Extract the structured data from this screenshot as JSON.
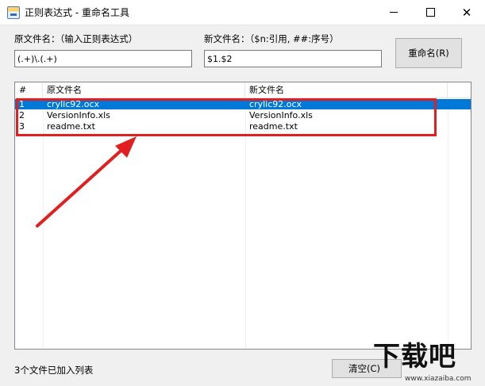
{
  "window": {
    "title": "正则表达式 - 重命名工具",
    "min_glyph": "",
    "close_glyph": "✕"
  },
  "form": {
    "source_label": "原文件名：（输入正则表达式）",
    "source_value": "(.+)\\.(.+)",
    "target_label": "新文件名：（$n:引用, ##:序号）",
    "target_value": "$1.$2",
    "rename_button": "重命名(R)"
  },
  "list": {
    "columns": [
      "#",
      "原文件名",
      "新文件名"
    ],
    "rows": [
      {
        "index": "1",
        "original": "crylic92.ocx",
        "renamed": "crylic92.ocx",
        "selected": true
      },
      {
        "index": "2",
        "original": "VersionInfo.xls",
        "renamed": "VersionInfo.xls",
        "selected": false
      },
      {
        "index": "3",
        "original": "readme.txt",
        "renamed": "readme.txt",
        "selected": false
      }
    ]
  },
  "status": {
    "text": "3个文件已加入列表",
    "clear_button": "清空(C)"
  },
  "watermark": {
    "big": "下载吧",
    "small": "www.xiazaiba.com"
  },
  "colors": {
    "selection": "#0078d7",
    "annotation_red": "#e02020"
  }
}
